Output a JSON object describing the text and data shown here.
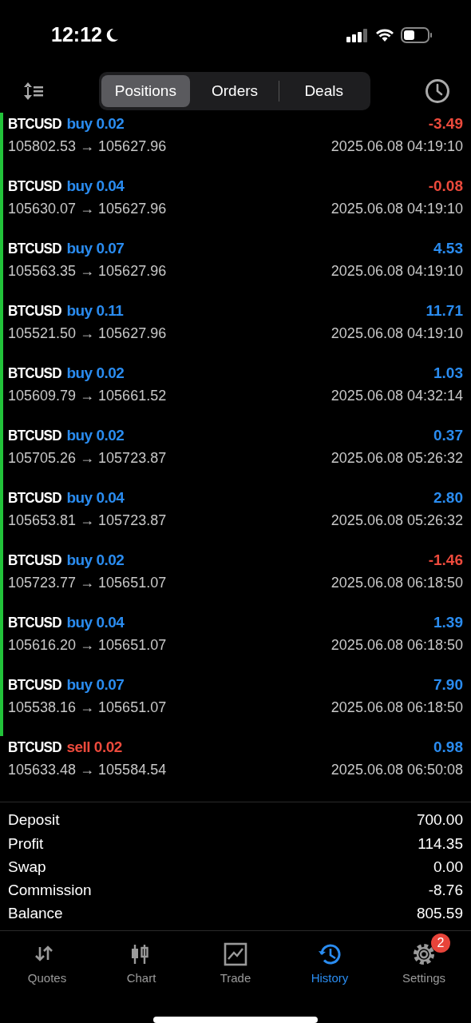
{
  "status_bar": {
    "time": "12:12"
  },
  "segments": [
    {
      "label": "Positions",
      "selected": true
    },
    {
      "label": "Orders",
      "selected": false
    },
    {
      "label": "Deals",
      "selected": false
    }
  ],
  "trades": [
    {
      "symbol": "BTCUSD",
      "kind": "buy",
      "volume": "buy 0.02",
      "profit": "-3.49",
      "color": "#ec4a3c",
      "prices": "105802.53 → 105627.96",
      "time": "2025.06.08 04:19:10",
      "marked": true
    },
    {
      "symbol": "BTCUSD",
      "kind": "buy",
      "volume": "buy 0.04",
      "profit": "-0.08",
      "color": "#ec4a3c",
      "prices": "105630.07 → 105627.96",
      "time": "2025.06.08 04:19:10",
      "marked": true
    },
    {
      "symbol": "BTCUSD",
      "kind": "buy",
      "volume": "buy 0.07",
      "profit": "4.53",
      "color": "#2a8cf0",
      "prices": "105563.35 → 105627.96",
      "time": "2025.06.08 04:19:10",
      "marked": true
    },
    {
      "symbol": "BTCUSD",
      "kind": "buy",
      "volume": "buy 0.11",
      "profit": "11.71",
      "color": "#2a8cf0",
      "prices": "105521.50 → 105627.96",
      "time": "2025.06.08 04:19:10",
      "marked": true
    },
    {
      "symbol": "BTCUSD",
      "kind": "buy",
      "volume": "buy 0.02",
      "profit": "1.03",
      "color": "#2a8cf0",
      "prices": "105609.79 → 105661.52",
      "time": "2025.06.08 04:32:14",
      "marked": true
    },
    {
      "symbol": "BTCUSD",
      "kind": "buy",
      "volume": "buy 0.02",
      "profit": "0.37",
      "color": "#2a8cf0",
      "prices": "105705.26 → 105723.87",
      "time": "2025.06.08 05:26:32",
      "marked": true
    },
    {
      "symbol": "BTCUSD",
      "kind": "buy",
      "volume": "buy 0.04",
      "profit": "2.80",
      "color": "#2a8cf0",
      "prices": "105653.81 → 105723.87",
      "time": "2025.06.08 05:26:32",
      "marked": true
    },
    {
      "symbol": "BTCUSD",
      "kind": "buy",
      "volume": "buy 0.02",
      "profit": "-1.46",
      "color": "#ec4a3c",
      "prices": "105723.77 → 105651.07",
      "time": "2025.06.08 06:18:50",
      "marked": true
    },
    {
      "symbol": "BTCUSD",
      "kind": "buy",
      "volume": "buy 0.04",
      "profit": "1.39",
      "color": "#2a8cf0",
      "prices": "105616.20 → 105651.07",
      "time": "2025.06.08 06:18:50",
      "marked": true
    },
    {
      "symbol": "BTCUSD",
      "kind": "buy",
      "volume": "buy 0.07",
      "profit": "7.90",
      "color": "#2a8cf0",
      "prices": "105538.16 → 105651.07",
      "time": "2025.06.08 06:18:50",
      "marked": true
    },
    {
      "symbol": "BTCUSD",
      "kind": "sell",
      "volume": "sell 0.02",
      "profit": "0.98",
      "color": "#2a8cf0",
      "prices": "105633.48 → 105584.54",
      "time": "2025.06.08 06:50:08",
      "marked": false
    }
  ],
  "summary": [
    {
      "label": "Deposit",
      "value": "700.00"
    },
    {
      "label": "Profit",
      "value": "114.35"
    },
    {
      "label": "Swap",
      "value": "0.00"
    },
    {
      "label": "Commission",
      "value": "-8.76"
    },
    {
      "label": "Balance",
      "value": "805.59"
    }
  ],
  "tab_bar": [
    {
      "label": "Quotes",
      "kind": "quotes",
      "selected": false
    },
    {
      "label": "Chart",
      "kind": "chart",
      "selected": false
    },
    {
      "label": "Trade",
      "kind": "trade",
      "selected": false
    },
    {
      "label": "History",
      "kind": "history",
      "selected": true
    },
    {
      "label": "Settings",
      "kind": "settings",
      "selected": false,
      "badge": "2"
    }
  ]
}
